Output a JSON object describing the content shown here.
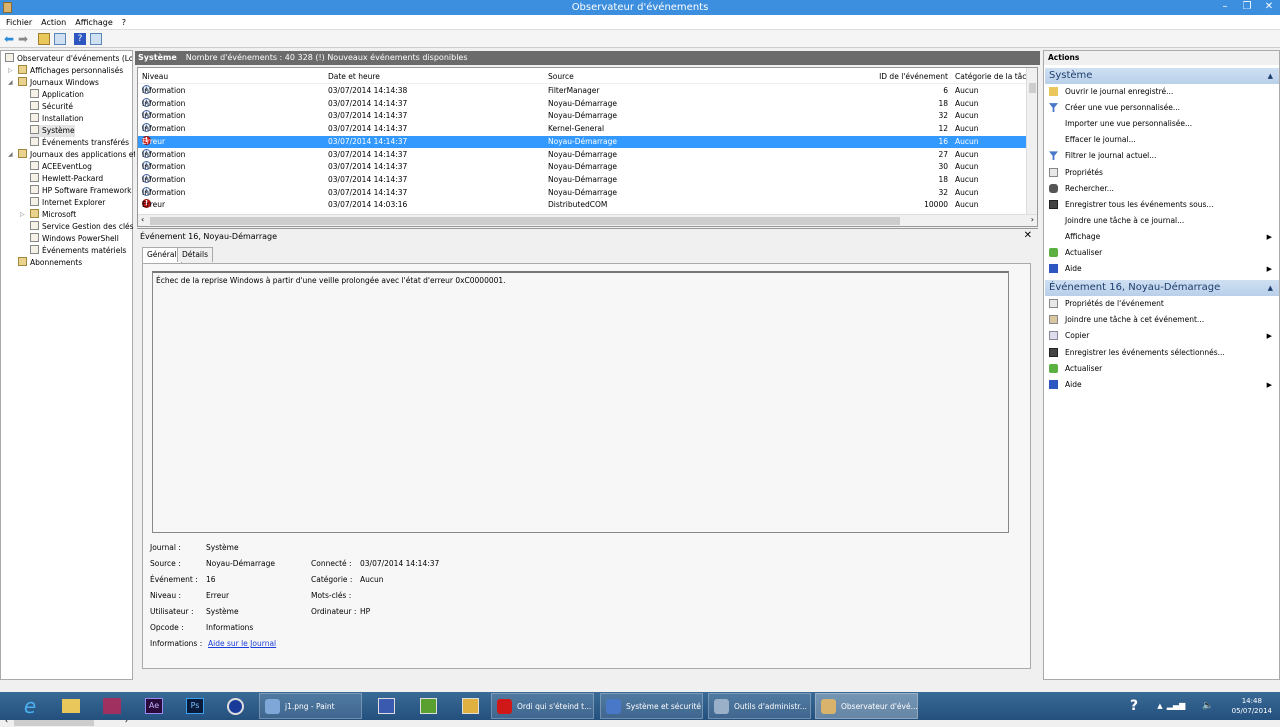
{
  "window": {
    "title": "Observateur d'événements"
  },
  "menu": [
    "Fichier",
    "Action",
    "Affichage",
    "?"
  ],
  "tree": {
    "root": "Observateur d'événements (Local)",
    "items": [
      {
        "label": "Affichages personnalisés",
        "level": 1
      },
      {
        "label": "Journaux Windows",
        "level": 1
      },
      {
        "label": "Application",
        "level": 2
      },
      {
        "label": "Sécurité",
        "level": 2
      },
      {
        "label": "Installation",
        "level": 2
      },
      {
        "label": "Système",
        "level": 2,
        "selected": true
      },
      {
        "label": "Événements transférés",
        "level": 2
      },
      {
        "label": "Journaux des applications et",
        "level": 1
      },
      {
        "label": "ACEEventLog",
        "level": 2
      },
      {
        "label": "Hewlett-Packard",
        "level": 2
      },
      {
        "label": "HP Software Framework",
        "level": 2
      },
      {
        "label": "Internet Explorer",
        "level": 2
      },
      {
        "label": "Microsoft",
        "level": 2
      },
      {
        "label": "Service Gestion des clés",
        "level": 2
      },
      {
        "label": "Windows PowerShell",
        "level": 2
      },
      {
        "label": "Événements matériels",
        "level": 2
      },
      {
        "label": "Abonnements",
        "level": 1
      }
    ]
  },
  "list": {
    "title": "Système",
    "summary": "Nombre d'événements : 40 328 (!) Nouveaux événements disponibles",
    "columns": [
      "Niveau",
      "Date et heure",
      "Source",
      "ID de l'événement",
      "Catégorie de la tâche"
    ],
    "rows": [
      {
        "level": "Information",
        "date": "03/07/2014 14:14:38",
        "source": "FilterManager",
        "id": "6",
        "category": "Aucun"
      },
      {
        "level": "Information",
        "date": "03/07/2014 14:14:37",
        "source": "Noyau-Démarrage",
        "id": "18",
        "category": "Aucun"
      },
      {
        "level": "Information",
        "date": "03/07/2014 14:14:37",
        "source": "Noyau-Démarrage",
        "id": "32",
        "category": "Aucun"
      },
      {
        "level": "Information",
        "date": "03/07/2014 14:14:37",
        "source": "Kernel-General",
        "id": "12",
        "category": "Aucun"
      },
      {
        "level": "Erreur",
        "date": "03/07/2014 14:14:37",
        "source": "Noyau-Démarrage",
        "id": "16",
        "category": "Aucun",
        "selected": true
      },
      {
        "level": "Information",
        "date": "03/07/2014 14:14:37",
        "source": "Noyau-Démarrage",
        "id": "27",
        "category": "Aucun"
      },
      {
        "level": "Information",
        "date": "03/07/2014 14:14:37",
        "source": "Noyau-Démarrage",
        "id": "30",
        "category": "Aucun"
      },
      {
        "level": "Information",
        "date": "03/07/2014 14:14:37",
        "source": "Noyau-Démarrage",
        "id": "18",
        "category": "Aucun"
      },
      {
        "level": "Information",
        "date": "03/07/2014 14:14:37",
        "source": "Noyau-Démarrage",
        "id": "32",
        "category": "Aucun"
      },
      {
        "level": "Erreur",
        "date": "03/07/2014 14:03:16",
        "source": "DistributedCOM",
        "id": "10000",
        "category": "Aucun"
      }
    ]
  },
  "detail": {
    "title": "Événement 16, Noyau-Démarrage",
    "tabs": [
      "Général",
      "Détails"
    ],
    "description": "Échec de la reprise Windows à partir d'une veille prolongée avec l'état d'erreur 0xC0000001.",
    "fields": {
      "journal_label": "Journal :",
      "journal": "Système",
      "source_label": "Source :",
      "source": "Noyau-Démarrage",
      "event_label": "Événement :",
      "event": "16",
      "level_label": "Niveau :",
      "level": "Erreur",
      "user_label": "Utilisateur :",
      "user": "Système",
      "opcode_label": "Opcode :",
      "opcode": "Informations",
      "info_label": "Informations :",
      "info_link": "Aide sur le Journal",
      "logged_label": "Connecté :",
      "logged": "03/07/2014 14:14:37",
      "category_label": "Catégorie :",
      "category": "Aucun",
      "keywords_label": "Mots-clés :",
      "computer_label": "Ordinateur :",
      "computer": "HP"
    }
  },
  "actions": {
    "title": "Actions",
    "sections": [
      {
        "title": "Système",
        "items": [
          {
            "label": "Ouvrir le journal enregistré...",
            "icon": "folder-open"
          },
          {
            "label": "Créer une vue personnalisée...",
            "icon": "filter"
          },
          {
            "label": "Importer une vue personnalisée...",
            "icon": ""
          },
          {
            "label": "Effacer le journal...",
            "icon": ""
          },
          {
            "label": "Filtrer le journal actuel...",
            "icon": "filter"
          },
          {
            "label": "Propriétés",
            "icon": "properties"
          },
          {
            "label": "Rechercher...",
            "icon": "binoculars"
          },
          {
            "label": "Enregistrer tous les événements sous...",
            "icon": "save"
          },
          {
            "label": "Joindre une tâche à ce journal...",
            "icon": ""
          },
          {
            "label": "Affichage",
            "icon": "",
            "submenu": true
          },
          {
            "label": "Actualiser",
            "icon": "refresh"
          },
          {
            "label": "Aide",
            "icon": "help",
            "submenu": true
          }
        ]
      },
      {
        "title": "Événement 16, Noyau-Démarrage",
        "items": [
          {
            "label": "Propriétés de l'événement",
            "icon": "properties"
          },
          {
            "label": "Joindre une tâche à cet événement...",
            "icon": "task"
          },
          {
            "label": "Copier",
            "icon": "copy",
            "submenu": true
          },
          {
            "label": "Enregistrer les événements sélectionnés...",
            "icon": "save"
          },
          {
            "label": "Actualiser",
            "icon": "refresh"
          },
          {
            "label": "Aide",
            "icon": "help",
            "submenu": true
          }
        ]
      }
    ]
  },
  "taskbar": {
    "windows": [
      {
        "label": "j1.png - Paint",
        "color": "#7fa8d8"
      },
      {
        "label": "Ordi qui s'éteind t...",
        "color": "#d01818"
      },
      {
        "label": "Système et sécurité",
        "color": "#4a78c8"
      },
      {
        "label": "Outils d'administr...",
        "color": "#9ab0c8"
      },
      {
        "label": "Observateur d'évé...",
        "color": "#d9b36b",
        "active": true
      }
    ],
    "time": "14:48",
    "date": "05/07/2014"
  }
}
